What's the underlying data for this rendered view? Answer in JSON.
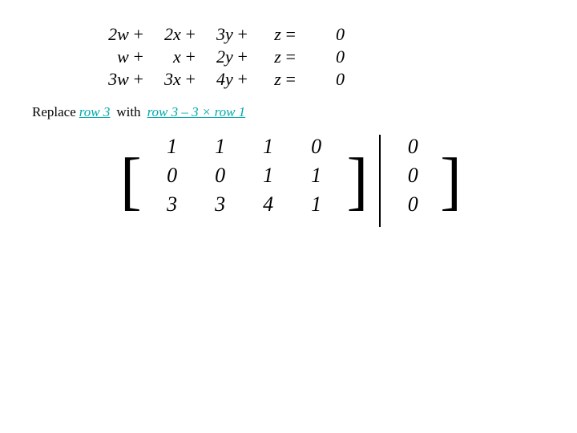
{
  "top_equations": [
    {
      "col1": "2w",
      "col2": "2x",
      "col3": "3y",
      "col4": "z",
      "rhs": "0"
    },
    {
      "col1": "w",
      "col2": "x",
      "col3": "2y",
      "col4": "z",
      "rhs": "0"
    },
    {
      "col1": "3w",
      "col2": "3x",
      "col3": "4y",
      "col4": "z",
      "rhs": "0"
    }
  ],
  "replace_label": "Replace",
  "replace_target": "row 3",
  "with_word": "with",
  "replace_expression": "row 3 – 3 × row 1",
  "matrix": {
    "rows": [
      {
        "c1": "1",
        "c2": "1",
        "c3": "1",
        "c4": "0",
        "c5": "│ 0"
      },
      {
        "c1": "0",
        "c2": "0",
        "c3": "1",
        "c4": "1",
        "c5": "│ 0"
      },
      {
        "c1": "3",
        "c2": "3",
        "c3": "4",
        "c4": "1",
        "c5": "│ 0"
      }
    ]
  }
}
